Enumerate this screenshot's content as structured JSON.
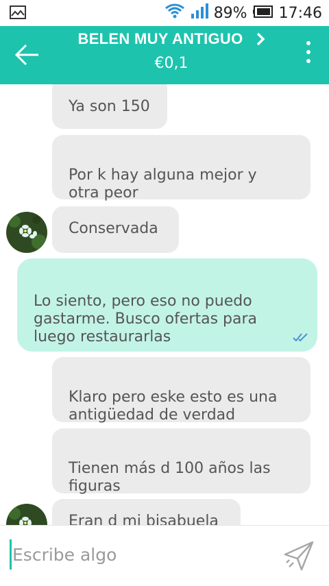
{
  "status_bar": {
    "battery": "89%",
    "time": "17:46"
  },
  "header": {
    "title": "BELEN MUY ANTIGUO",
    "subtitle": "€0,1"
  },
  "messages": [
    {
      "from": "them",
      "text": "Ya son 150"
    },
    {
      "from": "them",
      "text": "Por k hay alguna mejor y\notra peor"
    },
    {
      "from": "them",
      "text": "Conservada"
    },
    {
      "from": "me",
      "text": "Lo siento, pero eso no puedo\ngastarme. Busco ofertas para\nluego restaurarlas"
    },
    {
      "from": "them",
      "text": "Klaro pero eske esto es una\nantigüedad de verdad"
    },
    {
      "from": "them",
      "text": "Tienen más d 100 años las\nfiguras"
    },
    {
      "from": "them",
      "text": "Eran d mi bisabuela"
    }
  ],
  "composer": {
    "placeholder": "Escribe algo"
  },
  "colors": {
    "accent": "#1dc3ad",
    "incoming_bubble": "#ebebeb",
    "outgoing_bubble": "#c2f4e6",
    "read_ticks": "#4a90d9"
  },
  "icons": [
    "gallery-icon",
    "wifi-icon",
    "signal-icon",
    "battery-icon",
    "back-arrow-icon",
    "chevron-right-icon",
    "more-vert-icon",
    "avatar-flower",
    "double-check-icon",
    "send-icon"
  ]
}
